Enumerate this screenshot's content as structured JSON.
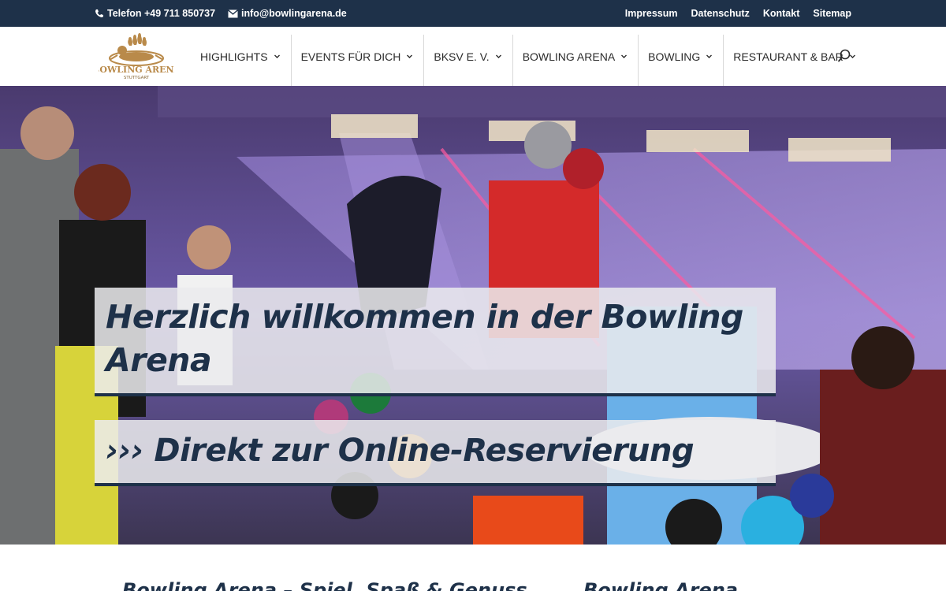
{
  "topbar": {
    "phone": "Telefon +49 711 850737",
    "email": "info@bowlingarena.de",
    "links": [
      "Impressum",
      "Datenschutz",
      "Kontakt",
      "Sitemap"
    ]
  },
  "logo": {
    "line1": "BOWLING ARENA",
    "line2": "STUTTGART"
  },
  "nav": [
    "HIGHLIGHTS",
    "EVENTS FÜR DICH",
    "BKSV E. V.",
    "BOWLING ARENA",
    "BOWLING",
    "RESTAURANT & BAR"
  ],
  "hero": {
    "headline": "Herzlich willkommen in der Bowling Arena",
    "cta": "››› Direkt zur Online-Reservierung"
  },
  "below": {
    "heading_left": "Bowling Arena – Spiel, Spaß & Genuss",
    "heading_right": "Bowling Arena"
  },
  "colors": {
    "navy": "#1e3149",
    "gold": "#b98a4a"
  }
}
